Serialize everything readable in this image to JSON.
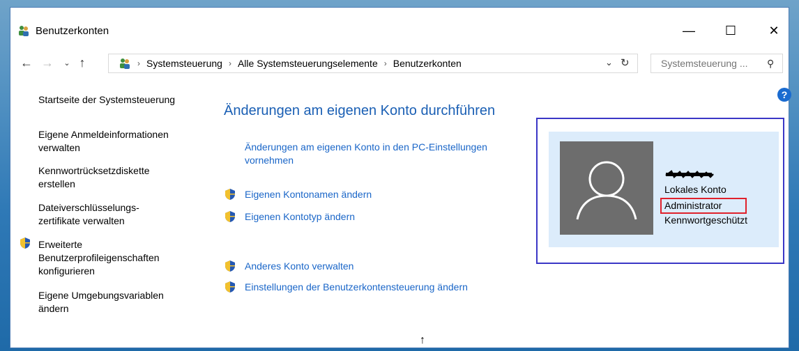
{
  "window": {
    "title": "Benutzerkonten"
  },
  "titlebar": {
    "minimize": "—",
    "maximize": "☐",
    "close": "✕"
  },
  "address_bar": {
    "crumbs": [
      "Systemsteuerung",
      "Alle Systemsteuerungselemente",
      "Benutzerkonten"
    ]
  },
  "search": {
    "placeholder": "Systemsteuerung ..."
  },
  "sidebar": {
    "items": [
      {
        "label": "Startseite der Systemsteuerung"
      },
      {
        "label": "Eigene Anmeldeinformationen verwalten"
      },
      {
        "label": "Kennwortrücksetzdiskette erstellen"
      },
      {
        "label": "Dateiverschlüsselungs-zertifikate verwalten"
      },
      {
        "label": "Erweiterte Benutzerprofileigenschaften konfigurieren"
      },
      {
        "label": "Eigene Umgebungsvariablen ändern"
      }
    ]
  },
  "main": {
    "title": "Änderungen am eigenen Konto durchführen",
    "tasks": [
      {
        "label": "Änderungen am eigenen Konto in den PC-Einstellungen vornehmen"
      },
      {
        "label": "Eigenen Kontonamen ändern"
      },
      {
        "label": "Eigenen Kontotyp ändern"
      },
      {
        "label": "Anderes Konto verwalten"
      },
      {
        "label": "Einstellungen der Benutzerkontensteuerung ändern"
      }
    ]
  },
  "account": {
    "lines": [
      "Lokales Konto",
      "Administrator",
      "Kennwortgeschützt"
    ]
  },
  "colors": {
    "accent": "#1a66c8",
    "highlight_box": "#e0202b",
    "card_outline": "#3a36c6",
    "card_bg": "#dcecfb"
  }
}
